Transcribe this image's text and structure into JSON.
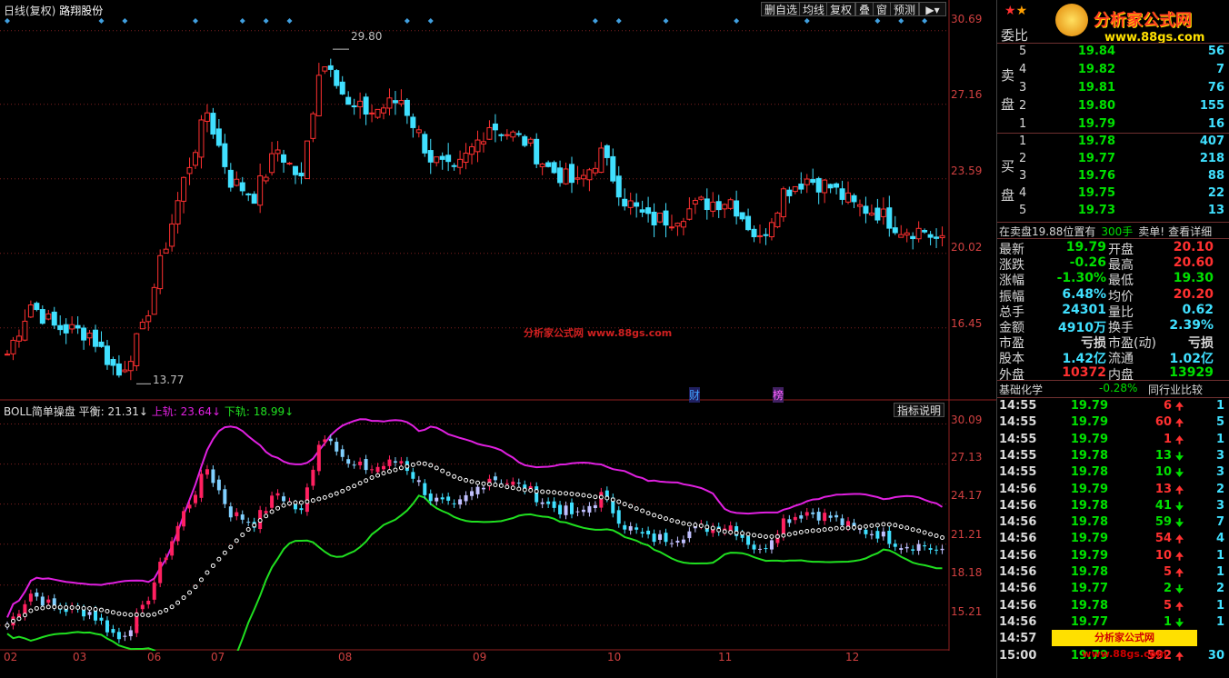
{
  "header": {
    "chart_mode": "日线(复权)",
    "stock_name": "路翔股份",
    "buttons": [
      "删自选",
      "均线",
      "复权",
      "叠",
      "窗",
      "预测"
    ]
  },
  "watermark": {
    "logo_text": "分析家公式网",
    "logo_url": "www.88gs.com",
    "center_text": "分析家公式网 www.88gs.com",
    "bottom_text": "分析家公式网 www.88gs.com"
  },
  "price_chart": {
    "y_ticks": [
      "30.69",
      "27.16",
      "23.59",
      "20.02",
      "16.45"
    ],
    "high_marker": "29.80",
    "low_marker": "13.77",
    "event_labels": [
      "财",
      "榜"
    ],
    "high_value": 29.8,
    "low_value": 13.77
  },
  "indicator": {
    "name": "BOLL简单操盘",
    "mid_label": "平衡: 21.31",
    "upper_label": "上轨: 23.64",
    "lower_label": "下轨: 18.99",
    "help_button": "指标说明",
    "y_ticks": [
      "30.09",
      "27.13",
      "24.17",
      "21.21",
      "18.18",
      "15.21"
    ]
  },
  "x_axis": {
    "months": [
      "02",
      "03",
      "06",
      "07",
      "08",
      "09",
      "10",
      "11",
      "12"
    ]
  },
  "order_book": {
    "title": "委比",
    "sell_label": [
      "卖",
      "盘"
    ],
    "buy_label": [
      "买",
      "盘"
    ],
    "sell": [
      {
        "level": "5",
        "price": "19.84",
        "vol": "56"
      },
      {
        "level": "4",
        "price": "19.82",
        "vol": "7"
      },
      {
        "level": "3",
        "price": "19.81",
        "vol": "76"
      },
      {
        "level": "2",
        "price": "19.80",
        "vol": "155"
      },
      {
        "level": "1",
        "price": "19.79",
        "vol": "16"
      }
    ],
    "buy": [
      {
        "level": "1",
        "price": "19.78",
        "vol": "407"
      },
      {
        "level": "2",
        "price": "19.77",
        "vol": "218"
      },
      {
        "level": "3",
        "price": "19.76",
        "vol": "88"
      },
      {
        "level": "4",
        "price": "19.75",
        "vol": "22"
      },
      {
        "level": "5",
        "price": "19.73",
        "vol": "13"
      }
    ],
    "notice_prefix": "在卖盘19.88位置有",
    "notice_qty": "300手",
    "notice_suffix": "卖单!",
    "notice_link": "查看详细"
  },
  "quote": [
    {
      "l1": "最新",
      "v1": "19.79",
      "l2": "开盘",
      "v2": "20.10"
    },
    {
      "l1": "涨跌",
      "v1": "-0.26",
      "l2": "最高",
      "v2": "20.60"
    },
    {
      "l1": "涨幅",
      "v1": "-1.30%",
      "l2": "最低",
      "v2": "19.30"
    },
    {
      "l1": "振幅",
      "v1": "6.48%",
      "l2": "均价",
      "v2": "20.20"
    },
    {
      "l1": "总手",
      "v1": "24301",
      "l2": "量比",
      "v2": "0.62"
    },
    {
      "l1": "金额",
      "v1": "4910万",
      "l2": "换手",
      "v2": "2.39%"
    },
    {
      "l1": "市盈",
      "v1": "亏损",
      "l2": "市盈(动)",
      "v2": "亏损"
    },
    {
      "l1": "股本",
      "v1": "1.42亿",
      "l2": "流通",
      "v2": "1.02亿"
    },
    {
      "l1": "外盘",
      "v1": "10372",
      "l2": "内盘",
      "v2": "13929"
    }
  ],
  "sector": {
    "name": "基础化学",
    "change": "-0.28%",
    "compare": "同行业比较"
  },
  "ticks": [
    {
      "time": "14:55",
      "price": "19.79",
      "vol": "6",
      "dir": "up",
      "n": "1"
    },
    {
      "time": "14:55",
      "price": "19.79",
      "vol": "60",
      "dir": "up",
      "n": "5"
    },
    {
      "time": "14:55",
      "price": "19.79",
      "vol": "1",
      "dir": "up",
      "n": "1"
    },
    {
      "time": "14:55",
      "price": "19.78",
      "vol": "13",
      "dir": "down",
      "n": "3"
    },
    {
      "time": "14:55",
      "price": "19.78",
      "vol": "10",
      "dir": "down",
      "n": "3"
    },
    {
      "time": "14:56",
      "price": "19.79",
      "vol": "13",
      "dir": "up",
      "n": "2"
    },
    {
      "time": "14:56",
      "price": "19.78",
      "vol": "41",
      "dir": "down",
      "n": "3"
    },
    {
      "time": "14:56",
      "price": "19.78",
      "vol": "59",
      "dir": "down",
      "n": "7"
    },
    {
      "time": "14:56",
      "price": "19.79",
      "vol": "54",
      "dir": "up",
      "n": "4"
    },
    {
      "time": "14:56",
      "price": "19.79",
      "vol": "10",
      "dir": "up",
      "n": "1"
    },
    {
      "time": "14:56",
      "price": "19.78",
      "vol": "5",
      "dir": "up",
      "n": "1"
    },
    {
      "time": "14:56",
      "price": "19.77",
      "vol": "2",
      "dir": "down",
      "n": "2"
    },
    {
      "time": "14:56",
      "price": "19.78",
      "vol": "5",
      "dir": "up",
      "n": "1"
    },
    {
      "time": "14:56",
      "price": "19.77",
      "vol": "1",
      "dir": "down",
      "n": "1"
    },
    {
      "time": "14:57",
      "price": "",
      "vol": "",
      "dir": "",
      "n": ""
    },
    {
      "time": "15:00",
      "price": "19.79",
      "vol": "592",
      "dir": "up",
      "n": "30"
    }
  ],
  "colors": {
    "up": "#ff3030",
    "down": "#40e0ff",
    "upper_band": "#e020e0",
    "lower_band": "#20e020",
    "mid_band": "#ffffff",
    "grid": "#802020"
  }
}
